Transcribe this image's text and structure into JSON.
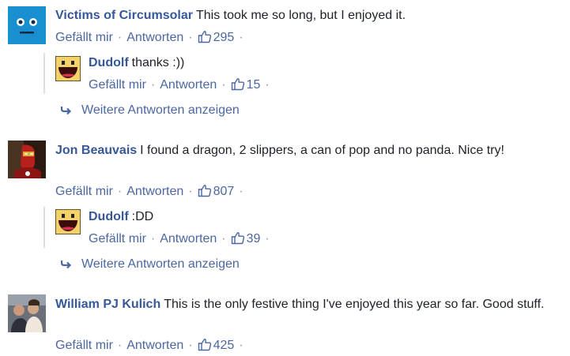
{
  "comments": [
    {
      "author": "Victims of Circumsolar",
      "text": "This took me so long, but I enjoyed it.",
      "like_label": "Gefällt mir",
      "reply_label": "Antworten",
      "likes": "295",
      "replies": [
        {
          "author": "Dudolf",
          "text": "thanks :))",
          "like_label": "Gefällt mir",
          "reply_label": "Antworten",
          "likes": "15"
        }
      ],
      "more_replies_label": "Weitere Antworten anzeigen"
    },
    {
      "author": "Jon Beauvais",
      "text": "I found a dragon, 2 slippers, a can of pop and no panda. Nice try!",
      "like_label": "Gefällt mir",
      "reply_label": "Antworten",
      "likes": "807",
      "replies": [
        {
          "author": "Dudolf",
          "text": ":DD",
          "like_label": "Gefällt mir",
          "reply_label": "Antworten",
          "likes": "39"
        }
      ],
      "more_replies_label": "Weitere Antworten anzeigen"
    },
    {
      "author": "William PJ Kulich",
      "text": "This is the only festive thing I've enjoyed this year so far. Good stuff.",
      "like_label": "Gefällt mir",
      "reply_label": "Antworten",
      "likes": "425"
    }
  ],
  "colors": {
    "author": "#365899",
    "link": "#4b67a1",
    "meta": "#90949c",
    "text": "#1d2129",
    "reply_line": "#dcdee3"
  }
}
